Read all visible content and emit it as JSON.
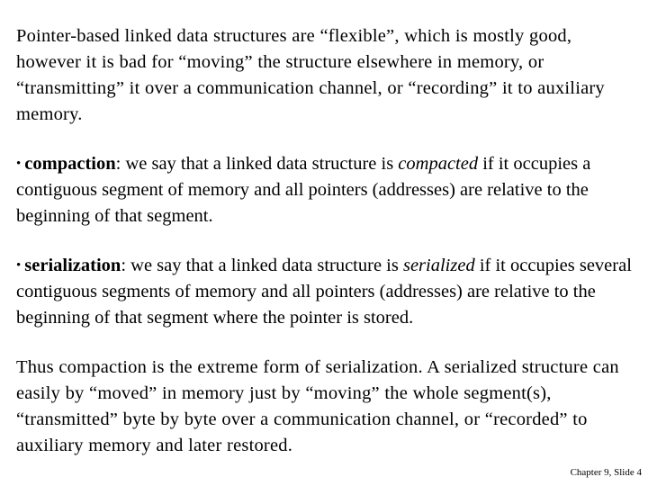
{
  "slide": {
    "paragraphs": [
      {
        "id": "intro",
        "type": "plain",
        "text": "Pointer-based linked data structures are “flexible”, which is mostly good, however it is bad for “moving” the structure elsewhere in memory, or “transmitting” it over a communication channel, or “recording” it to auxiliary memory."
      },
      {
        "id": "compaction",
        "type": "bullet",
        "bullet": "•",
        "term": "compaction",
        "after_term": ": we say that a linked data structure is ",
        "emphasis": "compacted",
        "tail": " if it occupies a contiguous segment of memory and all pointers (addresses) are relative to the beginning of that segment."
      },
      {
        "id": "serialization",
        "type": "bullet",
        "bullet": "•",
        "term": "serialization",
        "after_term": ": we say that a linked data structure is ",
        "emphasis": "serialized",
        "tail": " if it occupies several contiguous segments of memory and all pointers (addresses) are relative to the beginning of that segment where the pointer is stored."
      },
      {
        "id": "summary",
        "type": "plain",
        "text": "Thus compaction is the extreme form of serialization. A serialized structure can easily by “moved” in memory just by “moving” the whole segment(s), “transmitted” byte by byte over a communication channel, or “recorded” to auxiliary memory and later restored."
      }
    ],
    "footer": "Chapter 9, Slide 4",
    "colors": {
      "background": "#ffffff",
      "text": "#000000"
    }
  }
}
